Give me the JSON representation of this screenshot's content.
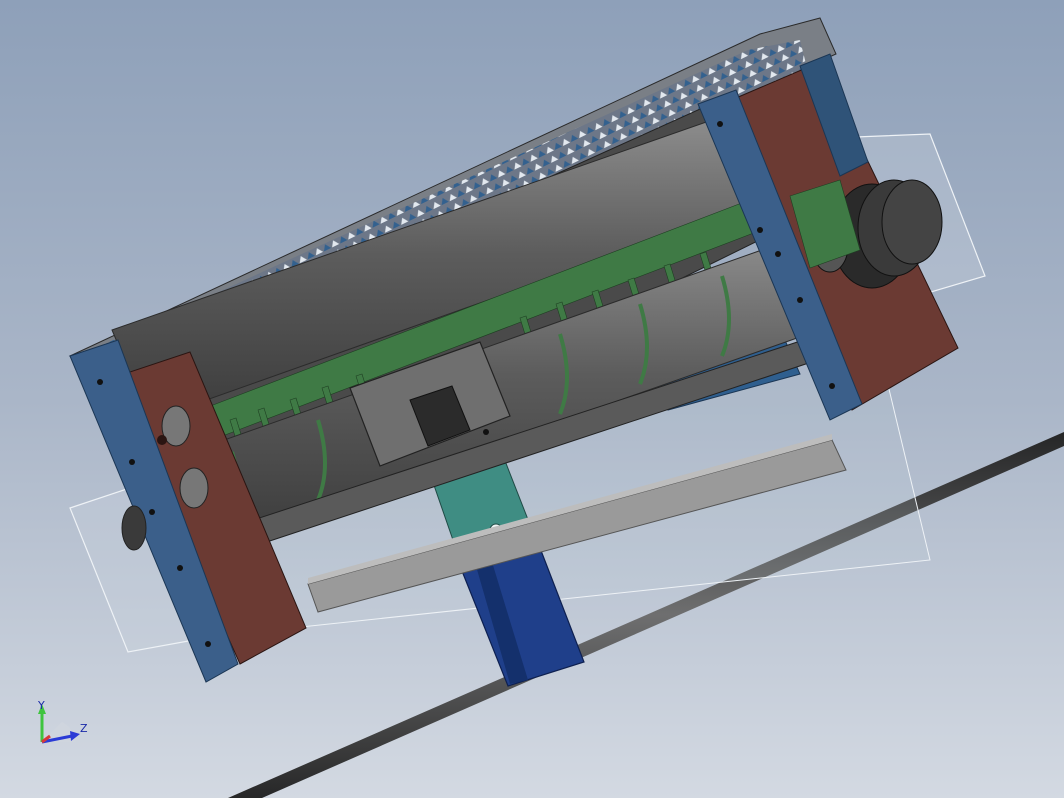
{
  "viewport": {
    "background_top": "#8ea0b9",
    "background_bottom": "#d3d9e2"
  },
  "model": {
    "frame_color": "#3b5f8a",
    "side_plate_color": "#6b3a33",
    "roller_color": "#6d6d6d",
    "comb_color": "#3f7a45",
    "rail_color": "#9a9a9a",
    "coupling_color": "#3f8d83",
    "column_color": "#1f3f8a",
    "glass_color": "#c9d1dc",
    "top_mesh_color": "#2f5f8f"
  },
  "triad": {
    "y_label": "Y",
    "z_label": "Z",
    "x_color": "#d63a3a",
    "y_color": "#3ec43e",
    "z_color": "#2b3bd6"
  }
}
